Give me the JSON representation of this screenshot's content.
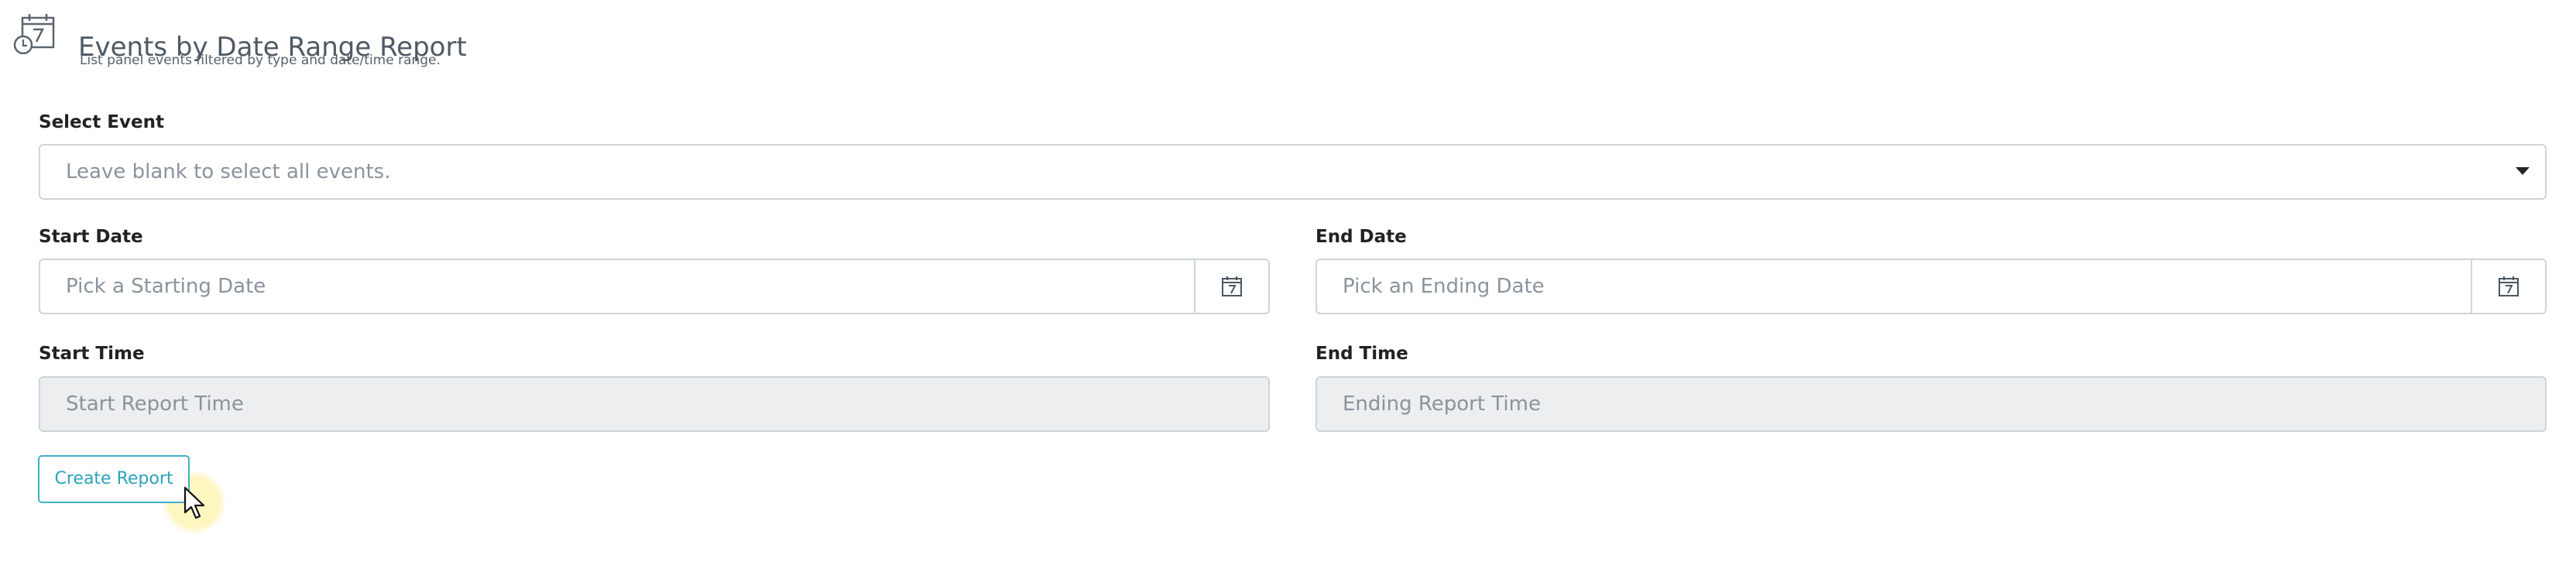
{
  "header": {
    "title": "Events by Date Range Report",
    "subtitle": "List panel events filtered by type and date/time range.",
    "icon": "calendar-clock-icon"
  },
  "form": {
    "select_event": {
      "label": "Select Event",
      "placeholder": "Leave blank to select all events.",
      "icon": "caret-down-icon"
    },
    "start_date": {
      "label": "Start Date",
      "placeholder": "Pick a Starting Date",
      "icon": "calendar-icon"
    },
    "end_date": {
      "label": "End Date",
      "placeholder": "Pick an Ending Date",
      "icon": "calendar-icon"
    },
    "start_time": {
      "label": "Start Time",
      "placeholder": "Start Report Time"
    },
    "end_time": {
      "label": "End Time",
      "placeholder": "Ending Report Time"
    },
    "submit_label": "Create Report"
  },
  "colors": {
    "title": "#4f5965",
    "button_accent": "#3fb1c6",
    "input_border": "#ced4da",
    "disabled_background": "#eceeef",
    "placeholder": "#8a939c"
  }
}
